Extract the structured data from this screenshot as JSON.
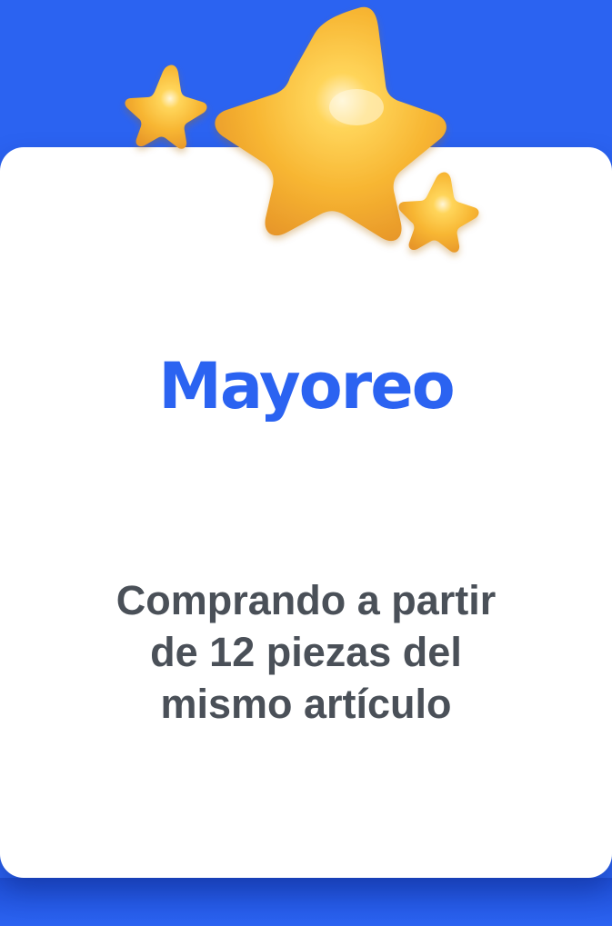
{
  "title": "Mayoreo",
  "description_lines": [
    "Comprando a partir",
    "de 12 piezas del",
    "mismo artículo"
  ],
  "icons": {
    "large_star": "star-icon",
    "small_star_left": "star-icon",
    "small_star_right": "star-icon"
  },
  "colors": {
    "background": "#2b63f1",
    "title": "#2b63f1",
    "text": "#4a5058",
    "star": "#f7b531"
  }
}
